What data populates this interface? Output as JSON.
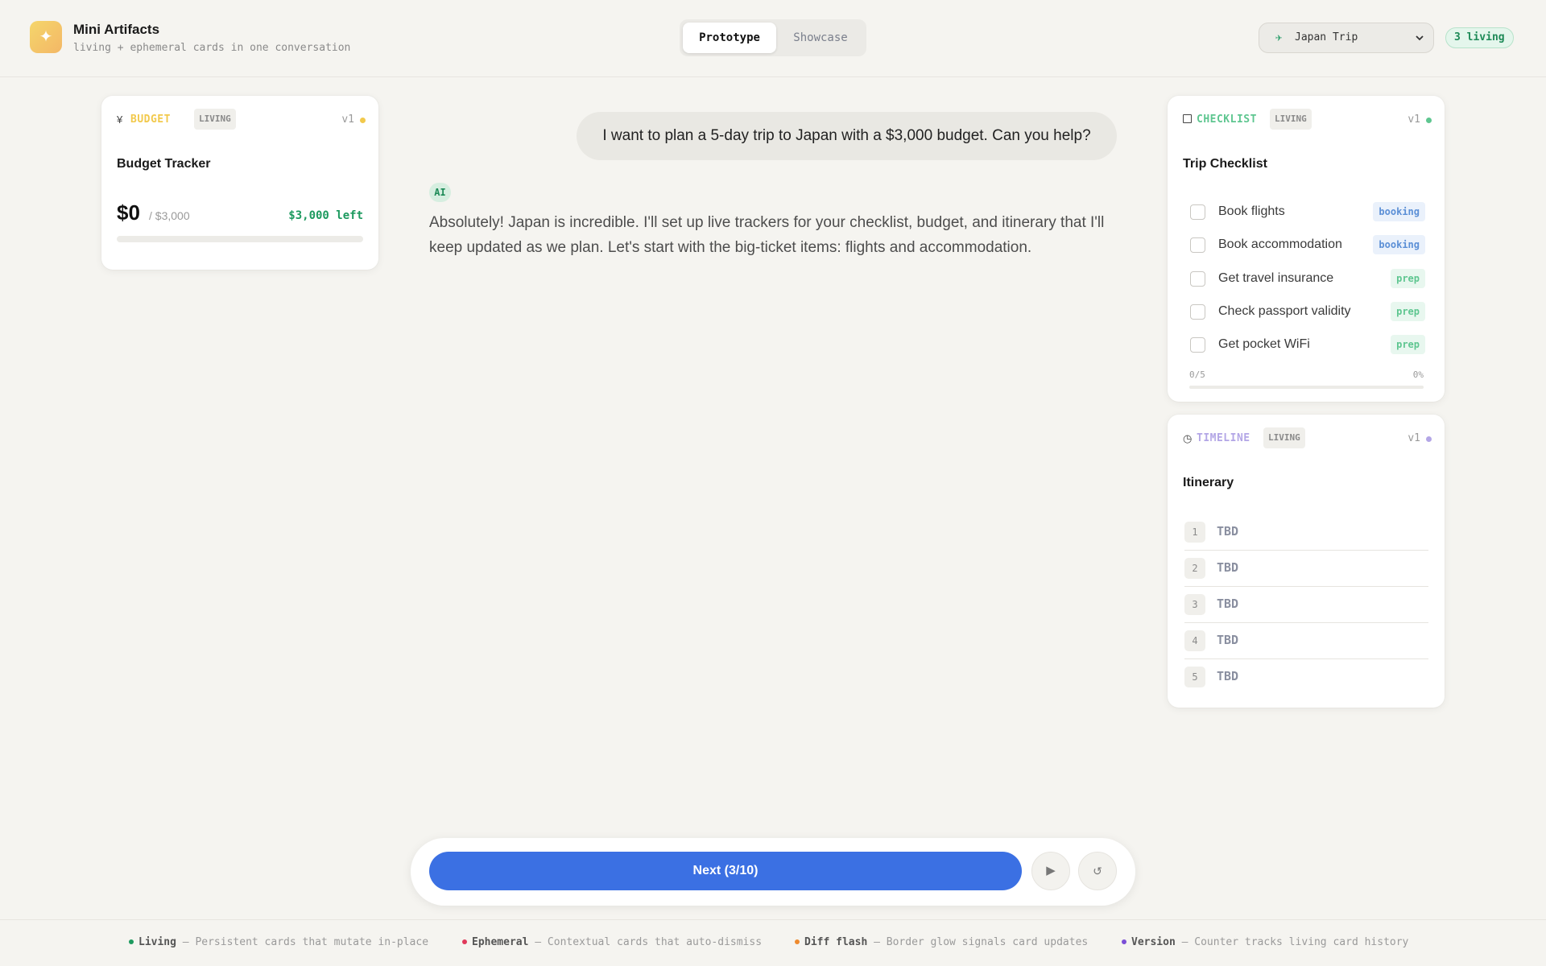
{
  "app": {
    "title": "Mini Artifacts",
    "subtitle": "living + ephemeral cards in one conversation",
    "logo_icon": "sparkle-icon"
  },
  "tabs": [
    {
      "label": "Prototype",
      "active": true
    },
    {
      "label": "Showcase",
      "active": false
    }
  ],
  "trip_select": {
    "value": "Japan Trip",
    "icon": "plane-icon"
  },
  "living_count": "3 living",
  "budget_card": {
    "icon": "¥",
    "label": "BUDGET",
    "badge": "LIVING",
    "version": "v1",
    "accent": "#f2c94c",
    "title": "Budget Tracker",
    "spent": "$0",
    "total": "/ $3,000",
    "left": "$3,000 left",
    "progress": 0
  },
  "chat": {
    "user_message": "I want to plan a 5-day trip to Japan with a $3,000 budget. Can you help?",
    "ai_badge": "AI",
    "ai_message": "Absolutely! Japan is incredible. I'll set up live trackers for your checklist, budget, and itinerary that I'll keep updated as we plan. Let's start with the big-ticket items: flights and accommodation."
  },
  "checklist_card": {
    "label": "CHECKLIST",
    "badge": "LIVING",
    "version": "v1",
    "accent": "#5ec690",
    "title": "Trip Checklist",
    "items": [
      {
        "text": "Book flights",
        "tag": "booking",
        "checked": false
      },
      {
        "text": "Book accommodation",
        "tag": "booking",
        "checked": false
      },
      {
        "text": "Get travel insurance",
        "tag": "prep",
        "checked": false
      },
      {
        "text": "Check passport validity",
        "tag": "prep",
        "checked": false
      },
      {
        "text": "Get pocket WiFi",
        "tag": "prep",
        "checked": false
      }
    ],
    "count": "0/5",
    "percent": "0%"
  },
  "timeline_card": {
    "label": "TIMELINE",
    "badge": "LIVING",
    "version": "v1",
    "accent": "#b3a6e6",
    "title": "Itinerary",
    "days": [
      {
        "num": "1",
        "text": "TBD"
      },
      {
        "num": "2",
        "text": "TBD"
      },
      {
        "num": "3",
        "text": "TBD"
      },
      {
        "num": "4",
        "text": "TBD"
      },
      {
        "num": "5",
        "text": "TBD"
      }
    ]
  },
  "controls": {
    "next_label": "Next (3/10)",
    "play_icon": "play-icon",
    "reset_icon": "reset-icon",
    "accent": "#3b70e3"
  },
  "legend": [
    {
      "name": "Living",
      "desc": "— Persistent cards that mutate in-place",
      "color": "#1d9a5f"
    },
    {
      "name": "Ephemeral",
      "desc": "— Contextual cards that auto-dismiss",
      "color": "#e0395a"
    },
    {
      "name": "Diff flash",
      "desc": "— Border glow signals card updates",
      "color": "#ee8a2e"
    },
    {
      "name": "Version",
      "desc": "— Counter tracks living card history",
      "color": "#7b4fd6"
    }
  ]
}
